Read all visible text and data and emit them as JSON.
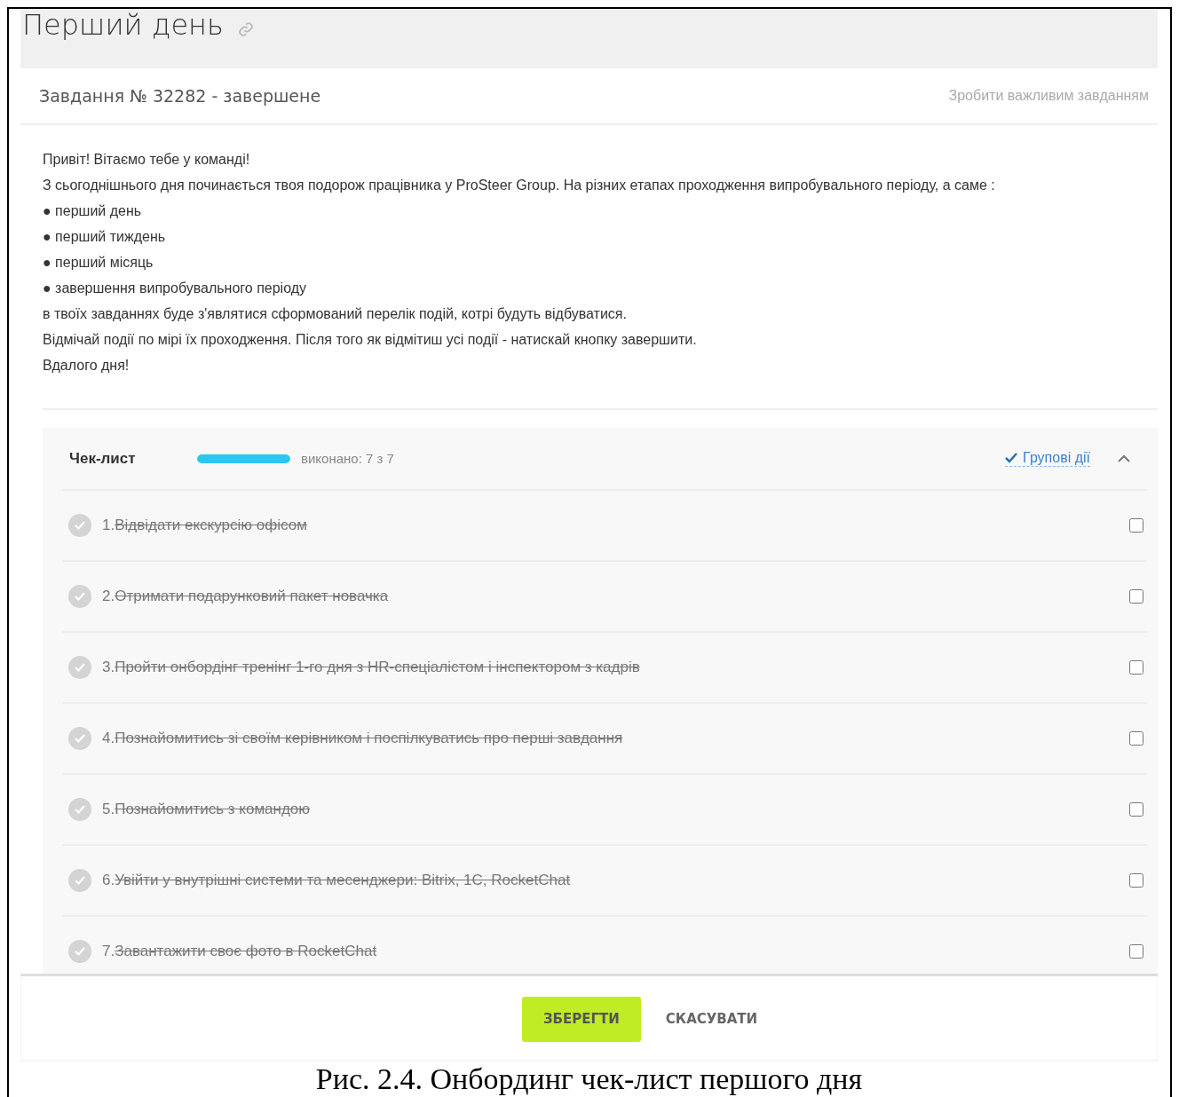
{
  "page_title": "Перший день",
  "task": {
    "label": "Завдання № 32282 - завершене",
    "action": "Зробити важливим завданням"
  },
  "description": [
    {
      "kind": "line",
      "text": "Привіт! Вітаємо тебе у команді!"
    },
    {
      "kind": "line",
      "text": "З сьогоднішнього дня починається твоя подорож працівника у ProSteer Group. На різних етапах проходження випробувального періоду, а саме :"
    },
    {
      "kind": "bullet",
      "marker": "●",
      "text": "перший день"
    },
    {
      "kind": "bullet",
      "marker": "●",
      "text": "перший тиждень"
    },
    {
      "kind": "bullet",
      "marker": "●",
      "text": "перший місяць"
    },
    {
      "kind": "bullet",
      "marker": "●",
      "text": "завершення випробувального періоду"
    },
    {
      "kind": "line",
      "text": "в твоїх завданнях буде з'являтися сформований перелік подій, котрі будуть відбуватися."
    },
    {
      "kind": "line",
      "text": "Відмічай події по мірі їх проходження. Після того як відмітиш усі події - натискай кнопку завершити."
    },
    {
      "kind": "line",
      "text": "Вдалого дня!"
    }
  ],
  "checklist": {
    "title": "Чек-лист",
    "level": 1,
    "progress_text": "виконано: 7 з 7",
    "group_actions": "Групові дії",
    "expanded": true,
    "items": [
      {
        "number": "1.",
        "text": "Відвідати екскурсію офісом",
        "done": true,
        "checked": false
      },
      {
        "number": "2.",
        "text": "Отримати подарунковий пакет новачка",
        "done": true,
        "checked": false
      },
      {
        "number": "3.",
        "text": "Пройти онбордінг тренінг 1-го дня з HR-спеціалістом і інспектором з кадрів",
        "done": true,
        "checked": false
      },
      {
        "number": "4.",
        "text": "Познайомитись зі своїм керівником і поспілкуватись про перші завдання",
        "done": true,
        "checked": false
      },
      {
        "number": "5.",
        "text": "Познайомитись з командою",
        "done": true,
        "checked": false
      },
      {
        "number": "6.",
        "text": "Увійти у внутрішні системи та месенджери: Bitrix, 1С, RocketChat",
        "done": true,
        "checked": false
      },
      {
        "number": "7.",
        "text": "Завантажити своє фото в RocketChat",
        "done": true,
        "checked": false
      }
    ]
  },
  "buttons": {
    "save": "ЗБЕРЕГТИ",
    "cancel": "СКАСУВАТИ"
  },
  "caption": "Рис. 2.4. Онбординг чек-лист першого дня"
}
